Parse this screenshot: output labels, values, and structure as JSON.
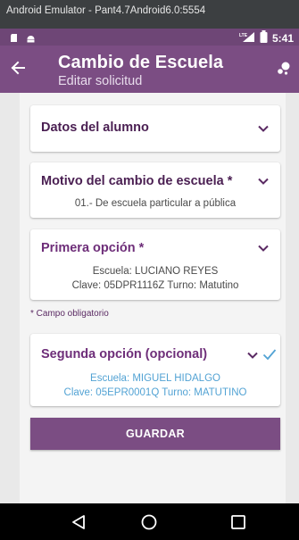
{
  "emulator": {
    "title": "Android Emulator - Pant4.7Android6.0:5554"
  },
  "status_bar": {
    "time": "5:41",
    "network_label": "LTE",
    "icons": [
      "sd-card-icon",
      "android-icon",
      "signal-icon",
      "battery-icon"
    ]
  },
  "app_bar": {
    "title": "Cambio de Escuela",
    "subtitle": "Editar solicitud",
    "back_icon": "arrow-back-icon",
    "action_icon": "bubbles-icon"
  },
  "cards": {
    "student": {
      "title": "Datos del alumno"
    },
    "reason": {
      "title": "Motivo del cambio de escuela *",
      "value": "01.- De escuela particular a pública"
    },
    "first_option": {
      "title": "Primera opción *",
      "school": "Escuela: LUCIANO REYES",
      "details": "Clave: 05DPR1116Z  Turno: Matutino"
    },
    "second_option": {
      "title": "Segunda opción (opcional)",
      "school": "Escuela: MIGUEL HIDALGO",
      "details": "Clave: 05EPR0001Q  Turno: MATUTINO"
    }
  },
  "required_note": "* Campo obligatorio",
  "save_button": {
    "label": "GUARDAR"
  },
  "colors": {
    "primary": "#7b4d83",
    "primary_dark": "#6e4676",
    "title_text": "#4a1f52",
    "link_blue": "#53a3d4"
  },
  "nav_bar": {
    "icons": [
      "back-triangle-icon",
      "home-circle-icon",
      "recents-square-icon"
    ]
  }
}
